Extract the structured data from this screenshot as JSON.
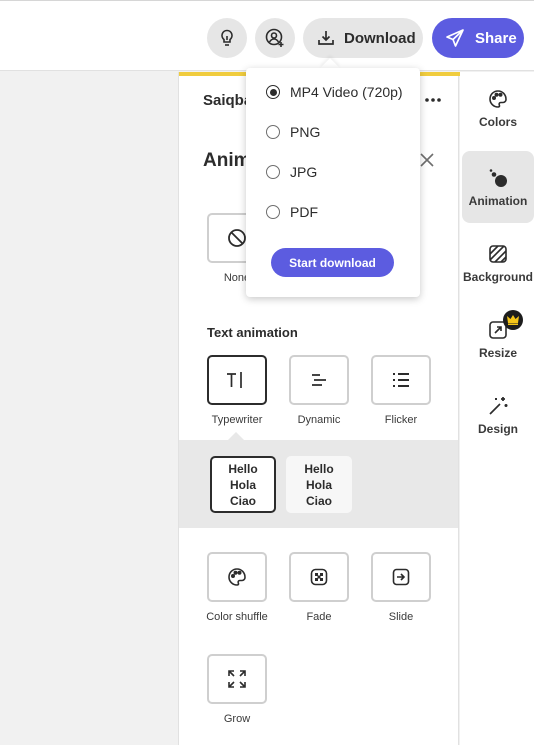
{
  "topbar": {
    "download_label": "Download",
    "share_label": "Share",
    "accent_color": "#5c5ce0"
  },
  "panel": {
    "owner_name": "Saiqba",
    "title": "Anim",
    "none_label": "None",
    "text_animation_title": "Text animation",
    "text_animations": [
      {
        "label": "Typewriter",
        "icon": "typewriter-icon"
      },
      {
        "label": "Dynamic",
        "icon": "dynamic-icon"
      },
      {
        "label": "Flicker",
        "icon": "flicker-icon"
      }
    ],
    "variants": [
      {
        "lines": [
          "Hello",
          "Hola",
          "Ciao"
        ]
      },
      {
        "lines": [
          "Hello",
          "Hola",
          "Ciao"
        ]
      }
    ],
    "other_animations": [
      {
        "label": "Color shuffle",
        "icon": "palette-icon"
      },
      {
        "label": "Fade",
        "icon": "fade-icon"
      },
      {
        "label": "Slide",
        "icon": "slide-icon"
      },
      {
        "label": "Grow",
        "icon": "grow-icon"
      }
    ]
  },
  "download_menu": {
    "options": [
      {
        "label": "MP4 Video (720p)",
        "checked": true
      },
      {
        "label": "PNG",
        "checked": false
      },
      {
        "label": "JPG",
        "checked": false
      },
      {
        "label": "PDF",
        "checked": false
      }
    ],
    "start_label": "Start download"
  },
  "rail": {
    "items": [
      {
        "label": "Colors",
        "icon": "palette-icon"
      },
      {
        "label": "Animation",
        "icon": "animation-icon",
        "active": true
      },
      {
        "label": "Background",
        "icon": "background-icon"
      },
      {
        "label": "Resize",
        "icon": "resize-icon",
        "premium": true
      },
      {
        "label": "Design",
        "icon": "magic-wand-icon"
      }
    ]
  }
}
